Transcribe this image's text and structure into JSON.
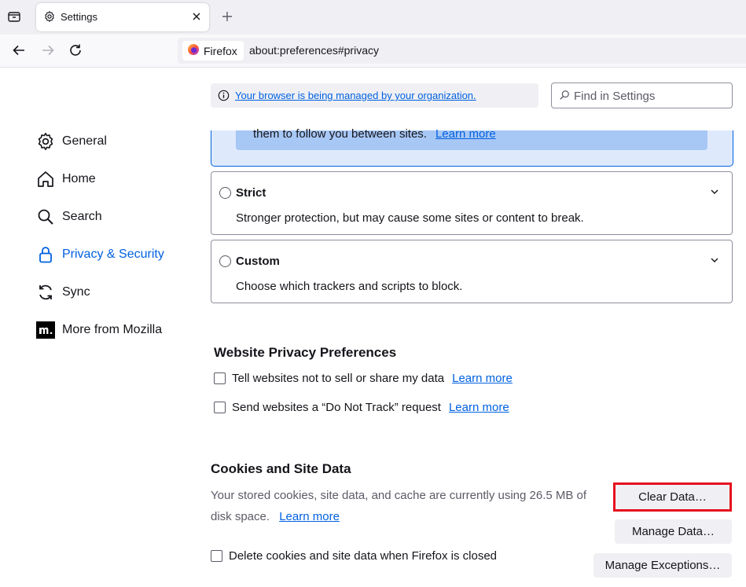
{
  "browser": {
    "tab_title": "Settings",
    "identity_label": "Firefox",
    "url": "about:preferences#privacy"
  },
  "header": {
    "managed_notice": "Your browser is being managed by your organization.",
    "search_placeholder": "Find in Settings"
  },
  "sidebar": {
    "items": [
      {
        "label": "General",
        "icon": "gear-icon"
      },
      {
        "label": "Home",
        "icon": "home-icon"
      },
      {
        "label": "Search",
        "icon": "magnifier-icon"
      },
      {
        "label": "Privacy & Security",
        "icon": "lock-icon",
        "active": true
      },
      {
        "label": "Sync",
        "icon": "sync-icon"
      },
      {
        "label": "More from Mozilla",
        "icon": "mozilla-logo-icon"
      }
    ]
  },
  "tracking": {
    "standard_partial_text": "them to follow you between sites.",
    "standard_learn_more": "Learn more",
    "strict": {
      "title": "Strict",
      "desc": "Stronger protection, but may cause some sites or content to break."
    },
    "custom": {
      "title": "Custom",
      "desc": "Choose which trackers and scripts to block."
    }
  },
  "website_privacy": {
    "title": "Website Privacy Preferences",
    "gpc_label": "Tell websites not to sell or share my data",
    "gpc_learn_more": "Learn more",
    "dnt_label": "Send websites a “Do Not Track” request",
    "dnt_learn_more": "Learn more"
  },
  "cookies": {
    "title": "Cookies and Site Data",
    "desc_line1": "Your stored cookies, site data, and cache are currently using 26.5 MB of",
    "desc_line2": "disk space.",
    "learn_more": "Learn more",
    "clear_button": "Clear Data…",
    "manage_button": "Manage Data…",
    "exceptions_button": "Manage Exceptions…",
    "delete_on_close_label": "Delete cookies and site data when Firefox is closed"
  },
  "colors": {
    "accent": "#0061e0",
    "highlight": "#e5121e"
  }
}
